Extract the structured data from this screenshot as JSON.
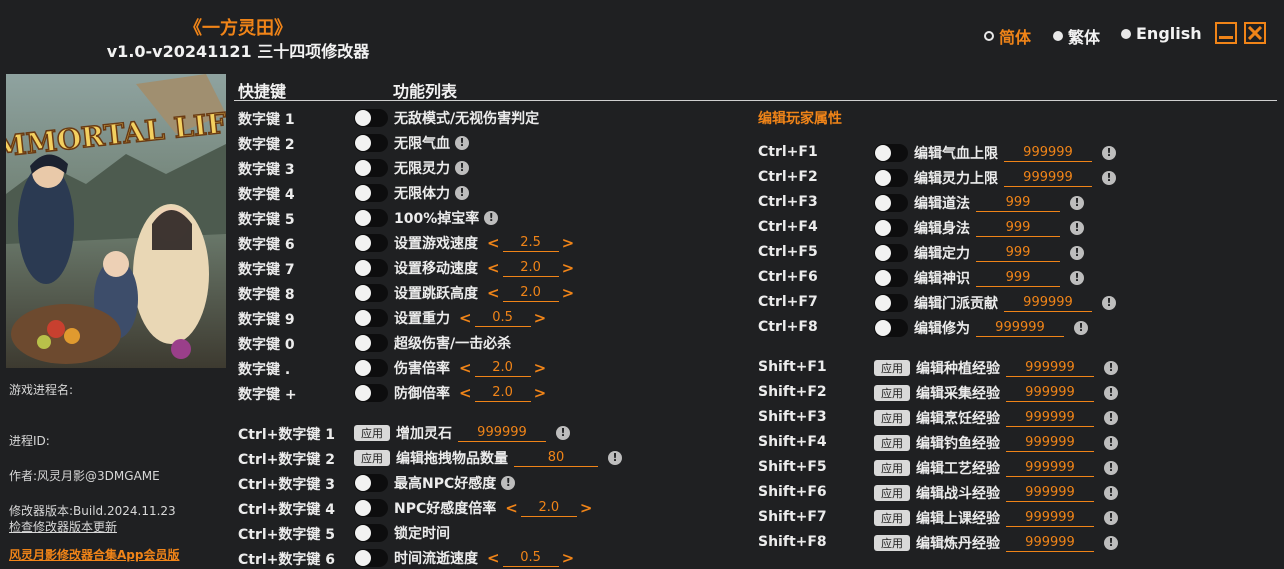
{
  "header": {
    "title": "《一方灵田》",
    "subtitle": "v1.0-v20241121 三十四项修改器"
  },
  "languages": [
    {
      "label": "简体",
      "selected": true
    },
    {
      "label": "繁体",
      "selected": false
    },
    {
      "label": "English",
      "selected": false
    }
  ],
  "cover": {
    "logo_text": "IMMORTAL LIFE"
  },
  "sidebar": {
    "process_name": "游戏进程名:",
    "process_id": "进程ID:",
    "author": "作者:风灵月影@3DMGAME",
    "version": "修改器版本:Build.2024.11.23",
    "check_update": "检查修改器版本更新",
    "homepage": "风灵月影修改器合集App会员版"
  },
  "columns": {
    "hotkey": "快捷键",
    "features": "功能列表"
  },
  "left_rows": [
    {
      "key": "数字键 1",
      "label": "无敌模式/无视伤害判定",
      "control": "toggle",
      "info": false
    },
    {
      "key": "数字键 2",
      "label": "无限气血",
      "control": "toggle",
      "info": true
    },
    {
      "key": "数字键 3",
      "label": "无限灵力",
      "control": "toggle",
      "info": true
    },
    {
      "key": "数字键 4",
      "label": "无限体力",
      "control": "toggle",
      "info": true
    },
    {
      "key": "数字键 5",
      "label": "100%掉宝率",
      "control": "toggle",
      "info": true
    },
    {
      "key": "数字键 6",
      "label": "设置游戏速度",
      "control": "toggle",
      "stepper": "2.5"
    },
    {
      "key": "数字键 7",
      "label": "设置移动速度",
      "control": "toggle",
      "stepper": "2.0"
    },
    {
      "key": "数字键 8",
      "label": "设置跳跃高度",
      "control": "toggle",
      "stepper": "2.0"
    },
    {
      "key": "数字键 9",
      "label": "设置重力",
      "control": "toggle",
      "stepper": "0.5"
    },
    {
      "key": "数字键 0",
      "label": "超级伤害/一击必杀",
      "control": "toggle"
    },
    {
      "key": "数字键 .",
      "label": "伤害倍率",
      "control": "toggle",
      "stepper": "2.0"
    },
    {
      "key": "数字键 +",
      "label": "防御倍率",
      "control": "toggle",
      "stepper": "2.0"
    },
    {
      "key": "Ctrl+数字键 1",
      "label": "增加灵石",
      "control": "apply",
      "input": "999999",
      "info": true
    },
    {
      "key": "Ctrl+数字键 2",
      "label": "编辑拖拽物品数量",
      "control": "apply",
      "input": "80",
      "info": true
    },
    {
      "key": "Ctrl+数字键 3",
      "label": "最高NPC好感度",
      "control": "toggle",
      "info": true
    },
    {
      "key": "Ctrl+数字键 4",
      "label": "NPC好感度倍率",
      "control": "toggle",
      "stepper": "2.0"
    },
    {
      "key": "Ctrl+数字键 5",
      "label": "锁定时间",
      "control": "toggle"
    },
    {
      "key": "Ctrl+数字键 6",
      "label": "时间流逝速度",
      "control": "toggle",
      "stepper": "0.5"
    }
  ],
  "right_section_title": "编辑玩家属性",
  "right_rows": [
    {
      "key": "Ctrl+F1",
      "label": "编辑气血上限",
      "control": "toggle",
      "input": "999999",
      "info": true
    },
    {
      "key": "Ctrl+F2",
      "label": "编辑灵力上限",
      "control": "toggle",
      "input": "999999",
      "info": true
    },
    {
      "key": "Ctrl+F3",
      "label": "编辑道法",
      "control": "toggle",
      "input": "999",
      "info": true
    },
    {
      "key": "Ctrl+F4",
      "label": "编辑身法",
      "control": "toggle",
      "input": "999",
      "info": true
    },
    {
      "key": "Ctrl+F5",
      "label": "编辑定力",
      "control": "toggle",
      "input": "999",
      "info": true
    },
    {
      "key": "Ctrl+F6",
      "label": "编辑神识",
      "control": "toggle",
      "input": "999",
      "info": true
    },
    {
      "key": "Ctrl+F7",
      "label": "编辑门派贡献",
      "control": "toggle",
      "input": "999999",
      "info": true
    },
    {
      "key": "Ctrl+F8",
      "label": "编辑修为",
      "control": "toggle",
      "input": "999999",
      "info": true
    },
    {
      "key": "Shift+F1",
      "label": "编辑种植经验",
      "control": "apply",
      "input": "999999",
      "info": true
    },
    {
      "key": "Shift+F2",
      "label": "编辑采集经验",
      "control": "apply",
      "input": "999999",
      "info": true
    },
    {
      "key": "Shift+F3",
      "label": "编辑烹饪经验",
      "control": "apply",
      "input": "999999",
      "info": true
    },
    {
      "key": "Shift+F4",
      "label": "编辑钓鱼经验",
      "control": "apply",
      "input": "999999",
      "info": true
    },
    {
      "key": "Shift+F5",
      "label": "编辑工艺经验",
      "control": "apply",
      "input": "999999",
      "info": true
    },
    {
      "key": "Shift+F6",
      "label": "编辑战斗经验",
      "control": "apply",
      "input": "999999",
      "info": true
    },
    {
      "key": "Shift+F7",
      "label": "编辑上课经验",
      "control": "apply",
      "input": "999999",
      "info": true
    },
    {
      "key": "Shift+F8",
      "label": "编辑炼丹经验",
      "control": "apply",
      "input": "999999",
      "info": true
    }
  ],
  "apply_label": "应用",
  "info_glyph": "!",
  "colors": {
    "accent": "#f08418",
    "background": "#1f2022",
    "text": "#ececec"
  }
}
